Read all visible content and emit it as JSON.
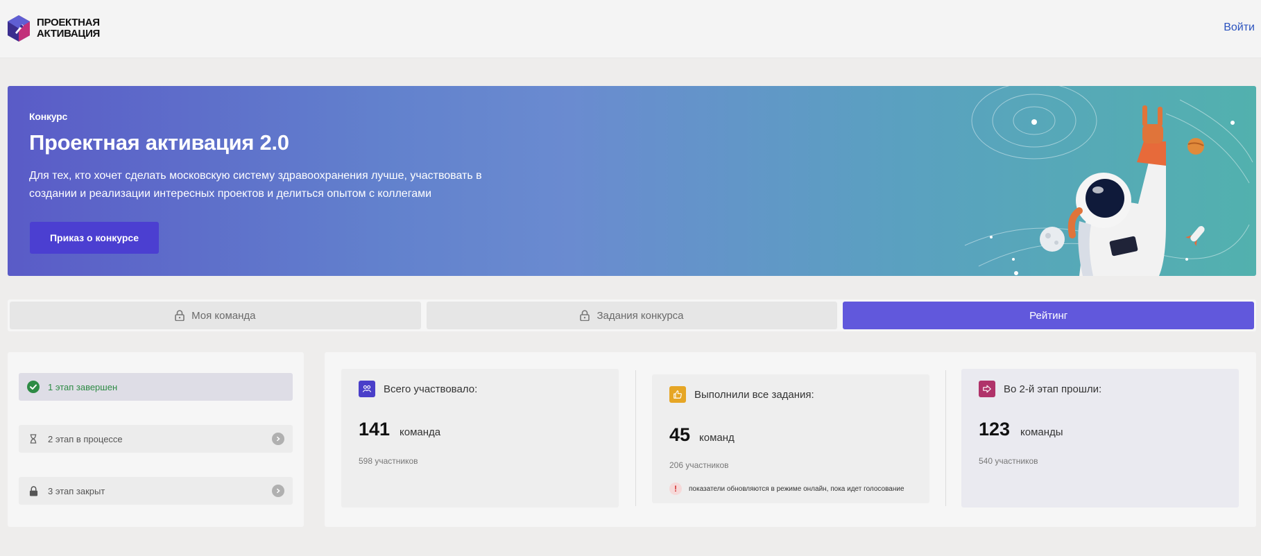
{
  "header": {
    "logo_line1": "ПРОЕКТНАЯ",
    "logo_line2": "АКТИВАЦИЯ",
    "login_label": "Войти"
  },
  "hero": {
    "kicker": "Конкурс",
    "title": "Проектная активация 2.0",
    "description": "Для тех, кто хочет сделать московскую систему здравоохранения лучше, участвовать в создании и реализации интересных проектов и делиться опытом с коллегами",
    "button_label": "Приказ о конкурсе"
  },
  "tabs": [
    {
      "label": "Моя команда",
      "locked": true,
      "active": false
    },
    {
      "label": "Задания конкурса",
      "locked": true,
      "active": false
    },
    {
      "label": "Рейтинг",
      "locked": false,
      "active": true
    }
  ],
  "stages": [
    {
      "label": "1 этап завершен",
      "status": "completed",
      "icon": "check-circle-icon"
    },
    {
      "label": "2 этап в процессе",
      "status": "in-progress",
      "icon": "hourglass-icon"
    },
    {
      "label": "3 этап закрыт",
      "status": "closed",
      "icon": "lock-icon"
    }
  ],
  "stats": [
    {
      "title": "Всего участвовало:",
      "number": "141",
      "unit": "команда",
      "sub": "598 участников",
      "icon": "team-icon",
      "icon_color": "#4a3fc9"
    },
    {
      "title": "Выполнили все задания:",
      "number": "45",
      "unit": "команд",
      "sub": "206 участников",
      "note": "показатели обновляются в режиме онлайн, пока идет голосование",
      "icon": "thumbs-up-icon",
      "icon_color": "#e6a625"
    },
    {
      "title": "Во 2-й этап прошли:",
      "number": "123",
      "unit": "команды",
      "sub": "540 участников",
      "icon": "arrow-right-icon",
      "icon_color": "#b0336a"
    }
  ],
  "colors": {
    "accent": "#6158dc",
    "button": "#4b3fd1",
    "link": "#2a52be",
    "completed": "#2e8b45"
  }
}
